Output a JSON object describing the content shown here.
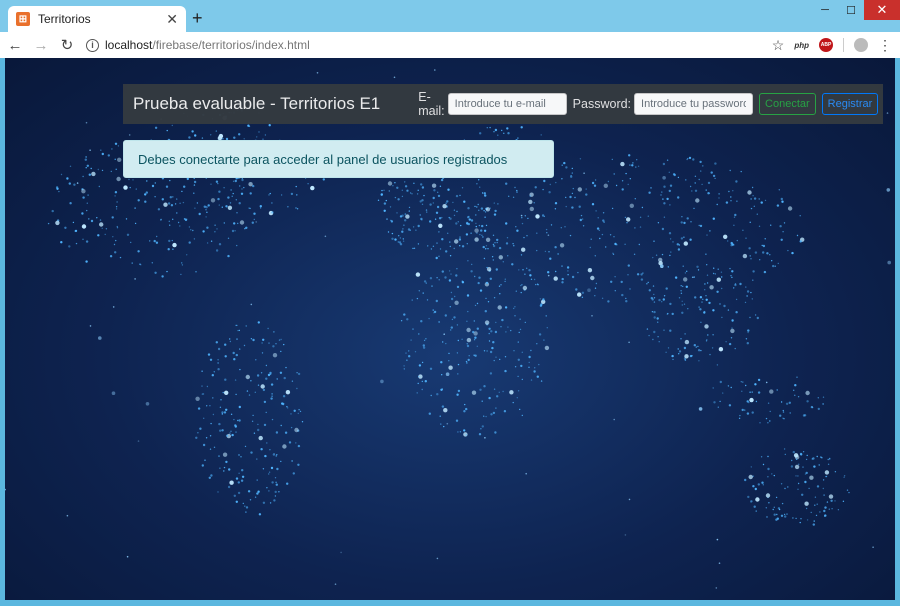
{
  "browser": {
    "tab_title": "Territorios",
    "url_host": "localhost",
    "url_path": "/firebase/territorios/index.html",
    "ext_php": "php",
    "ext_abp": "ABP"
  },
  "navbar": {
    "brand": "Prueba evaluable - Territorios E1",
    "email_label": "E-mail:",
    "email_placeholder": "Introduce tu e-mail",
    "password_label": "Password:",
    "password_placeholder": "Introduce tu password",
    "connect_label": "Conectar",
    "register_label": "Registrar"
  },
  "alert": {
    "message": "Debes conectarte para acceder al panel de usuarios registrados"
  },
  "colors": {
    "navbar_bg": "#343a40",
    "alert_bg": "#d1ecf1",
    "success": "#28a745",
    "primary": "#007bff",
    "map_bg": "#0e2350",
    "map_dots": "#4fb4ff"
  },
  "icons": [
    "tab-favicon-icon",
    "close-icon",
    "plus-icon",
    "back-arrow-icon",
    "forward-arrow-icon",
    "reload-icon",
    "info-icon",
    "star-icon",
    "php-extension-icon",
    "adblock-icon",
    "profile-icon",
    "menu-dots-icon"
  ]
}
